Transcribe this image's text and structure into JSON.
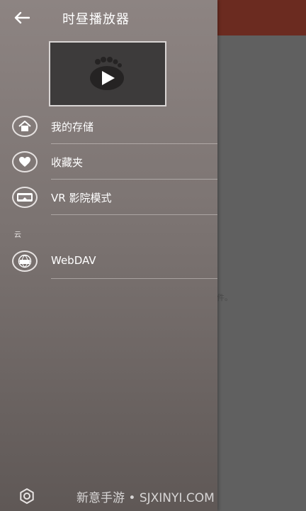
{
  "drawer": {
    "title": "时昼播放器",
    "menu": [
      {
        "label": "我的存储",
        "icon": "home-icon"
      },
      {
        "label": "收藏夹",
        "icon": "heart-icon"
      },
      {
        "label": "VR 影院模式",
        "icon": "vr-headset-icon"
      }
    ],
    "section_cloud": "云",
    "cloud_items": [
      {
        "label": "WebDAV",
        "icon": "globe-dav-icon"
      }
    ]
  },
  "background": {
    "partial_text": "件。"
  },
  "watermark": "新意手游 • SJXINYI.COM",
  "colors": {
    "topbar": "#6b2b20",
    "drawer_top": "#8d8482",
    "drawer_bottom": "#5f5856",
    "background": "#606060"
  }
}
